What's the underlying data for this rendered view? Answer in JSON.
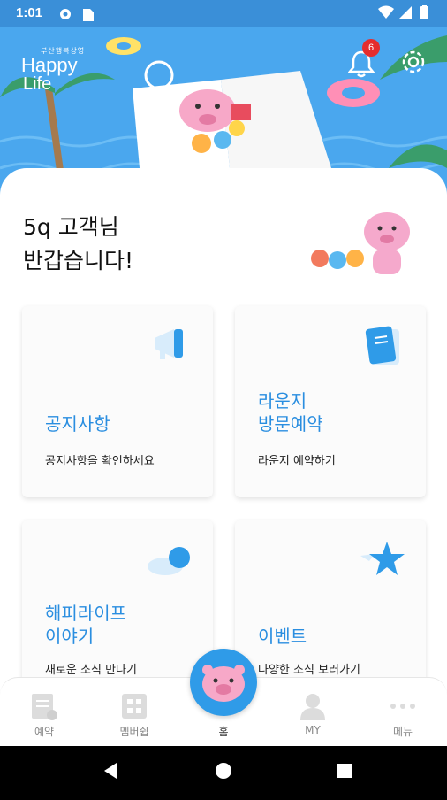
{
  "status_bar": {
    "time": "1:01"
  },
  "hero": {
    "logo_small": "부산행복상영",
    "logo_main": "Happy",
    "logo_sub": "Life",
    "notification_count": "6",
    "accent_color": "#4aa7ee"
  },
  "greeting": {
    "line1": "5q 고객님",
    "line2": "반갑습니다!"
  },
  "cards": [
    {
      "title": "공지사항",
      "desc": "공지사항을 확인하세요",
      "icon": "megaphone-icon"
    },
    {
      "title_line1": "라운지",
      "title_line2": "방문예약",
      "desc": "라운지 예약하기",
      "icon": "notebook-icon"
    },
    {
      "title_line1": "해피라이프",
      "title_line2": "이야기",
      "desc": "새로운 소식 만나기",
      "icon": "cloud-ball-icon"
    },
    {
      "title": "이벤트",
      "desc": "다양한 소식 보러가기",
      "icon": "star-icon"
    }
  ],
  "bottom_nav": {
    "items": [
      {
        "label": "예약",
        "icon": "document-check-icon"
      },
      {
        "label": "멤버쉽",
        "icon": "qr-code-icon"
      },
      {
        "label": "홈",
        "icon": "pig-home-icon"
      },
      {
        "label": "MY",
        "icon": "person-icon"
      },
      {
        "label": "메뉴",
        "icon": "more-dots-icon"
      }
    ],
    "active_color": "#2f9be8"
  }
}
